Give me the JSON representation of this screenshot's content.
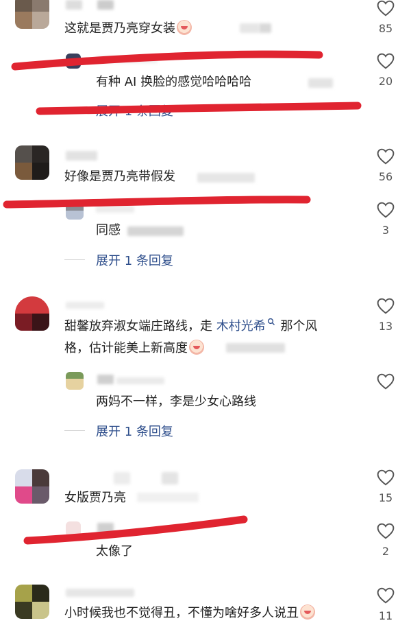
{
  "comments": [
    {
      "text": "这就是贾乃亮穿女装",
      "likes": "85"
    },
    {
      "text": "有种 AI 换脸的感觉哈哈哈哈",
      "likes": "20",
      "expand": "展开 1 条回复"
    },
    {
      "text": "好像是贾乃亮带假发",
      "likes": "56"
    },
    {
      "text": "同感",
      "likes": "3",
      "expand": "展开 1 条回复"
    },
    {
      "text_a": "甜馨放弃淑女端庄路线，走",
      "link": "木村光希",
      "text_b": "那个风",
      "text_c": "格，估计能美上新高度",
      "likes": "13"
    },
    {
      "text": "两妈不一样，李是少女心路线",
      "expand": "展开 1 条回复"
    },
    {
      "text": "女版贾乃亮",
      "likes": "15"
    },
    {
      "text": "太像了",
      "likes": "2"
    },
    {
      "text": "小时候我也不觉得丑，不懂为啥好多人说丑",
      "likes": "11"
    }
  ],
  "icons": {
    "like": "heart-outline-icon",
    "search": "search-icon"
  },
  "colors": {
    "accent": "#2f4f8c",
    "mark": "#e02430"
  }
}
